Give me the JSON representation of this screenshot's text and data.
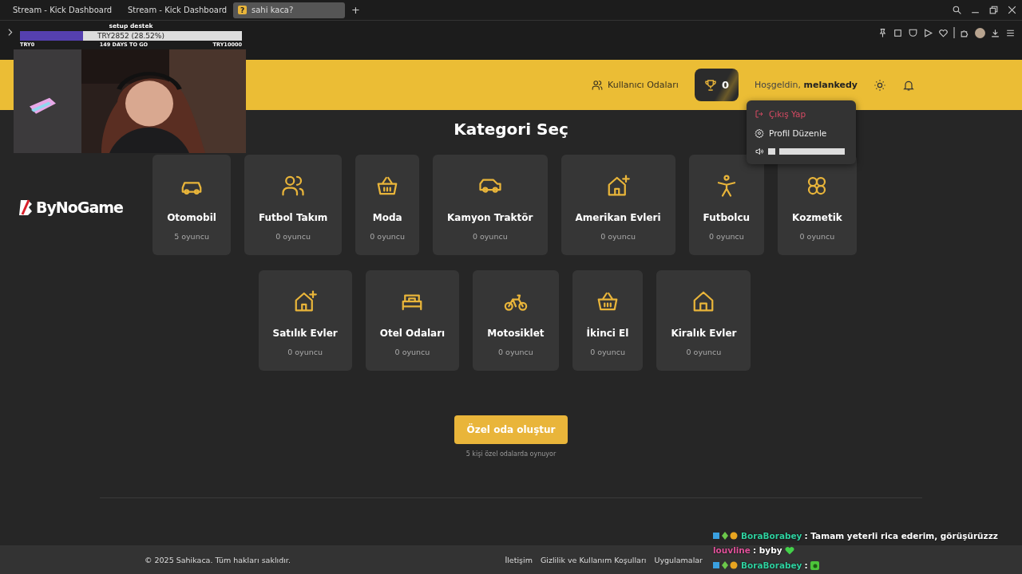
{
  "browser": {
    "tabs": [
      {
        "title": "Stream - Kick Dashboard",
        "selected": false,
        "kind": "kick"
      },
      {
        "title": "Stream - Kick Dashboard",
        "selected": false,
        "kind": "kick"
      },
      {
        "title": "sahi kaca?",
        "selected": true,
        "kind": "text",
        "favicon_text": "?"
      }
    ],
    "new_tab": "+"
  },
  "header": {
    "nav_link": "Kullanıcı Odaları",
    "trophy_count": "0",
    "greeting": "Hoşgeldin,",
    "username": "melankedy"
  },
  "user_menu": {
    "items": [
      {
        "kind": "logout",
        "label": "Çıkış Yap"
      },
      {
        "kind": "link",
        "label": "Profil Düzenle"
      },
      {
        "kind": "volume",
        "level": 0
      }
    ]
  },
  "page": {
    "title": "Kategori Seç",
    "categories": [
      {
        "name": "Otomobil",
        "players": "5 oyuncu",
        "kind": "car"
      },
      {
        "name": "Futbol Takım",
        "players": "0 oyuncu",
        "kind": "users"
      },
      {
        "name": "Moda",
        "players": "0 oyuncu",
        "kind": "basket"
      },
      {
        "name": "Kamyon Traktör",
        "players": "0 oyuncu",
        "kind": "truck"
      },
      {
        "name": "Amerikan Evleri",
        "players": "0 oyuncu",
        "kind": "house-plus"
      },
      {
        "name": "Futbolcu",
        "players": "0 oyuncu",
        "kind": "person"
      },
      {
        "name": "Kozmetik",
        "players": "0 oyuncu",
        "kind": "clover"
      },
      {
        "name": "Satılık Evler",
        "players": "0 oyuncu",
        "kind": "house-plus"
      },
      {
        "name": "Otel Odaları",
        "players": "0 oyuncu",
        "kind": "bed"
      },
      {
        "name": "Motosiklet",
        "players": "0 oyuncu",
        "kind": "bike"
      },
      {
        "name": "İkinci El",
        "players": "0 oyuncu",
        "kind": "basket"
      },
      {
        "name": "Kiralık Evler",
        "players": "0 oyuncu",
        "kind": "house"
      }
    ],
    "create_button": "Özel oda oluştur",
    "note": "5 kişi özel odalarda oynuyor"
  },
  "footer": {
    "copyright": "© 2025 Sahikaca. Tüm hakları saklıdır.",
    "links": [
      "İletişim",
      "Gizlilik ve Kullanım Koşulları",
      "Uygulamalar"
    ]
  },
  "overlays": {
    "goal": {
      "title": "setup destek",
      "level": 0.2852,
      "reading": "TRY2852 (28.52%)",
      "start": "TRY0",
      "days": "149 DAYS TO GO",
      "target": "TRY10000"
    },
    "logo": "ByNoGame",
    "chat": [
      {
        "user": "BoraBorabey",
        "color": "#2fd1a0",
        "badges": true,
        "message": ": Tamam yeterli rica ederim, görüşürüzzz",
        "kind": "plain"
      },
      {
        "user": "louvline",
        "color": "#e0529a",
        "badges": false,
        "message": ": byby",
        "kind": "heart"
      },
      {
        "user": "BoraBorabey",
        "color": "#2fd1a0",
        "badges": true,
        "message": ":",
        "kind": "green"
      }
    ]
  }
}
